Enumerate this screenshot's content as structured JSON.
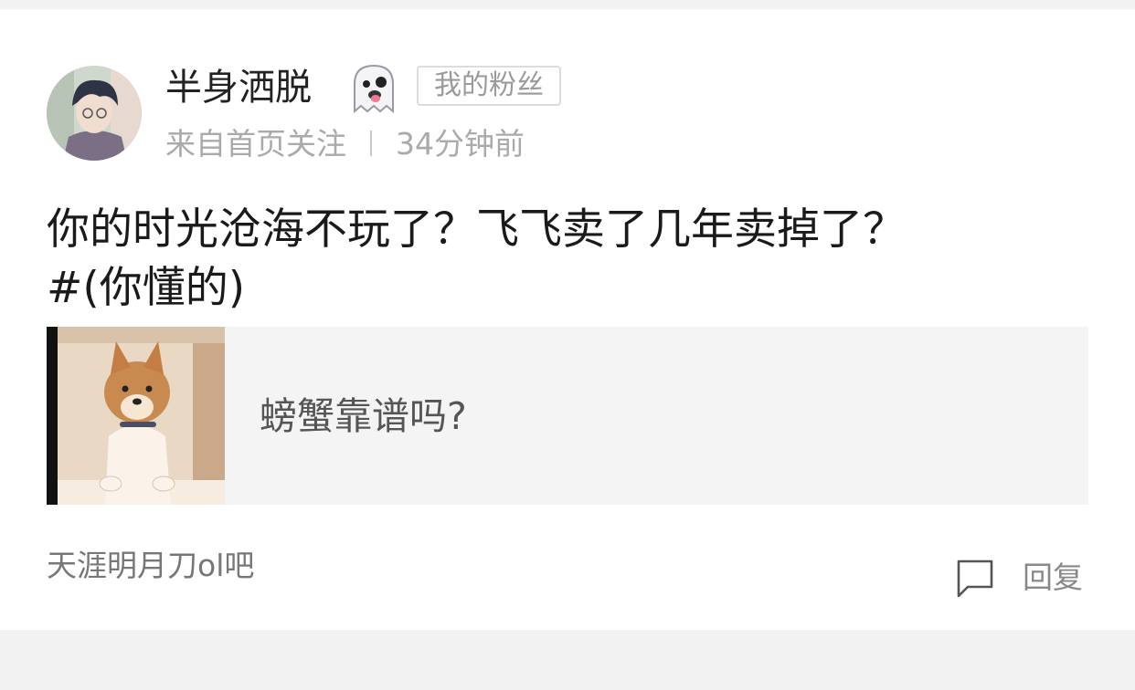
{
  "post": {
    "author": {
      "name": "半身洒脱",
      "emoji_icon": "ghost-tongue-icon",
      "badge": "我的粉丝"
    },
    "meta": {
      "source": "来自首页关注",
      "time": "34分钟前"
    },
    "content": {
      "line1": "你的时光沧海不玩了？飞飞卖了几年卖掉了？",
      "line2": "#(你懂的)"
    },
    "share": {
      "title": "螃蟹靠谱吗?"
    },
    "forum": "天涯明月刀ol吧",
    "actions": {
      "reply_label": "回复",
      "reply_icon": "comment-icon"
    }
  },
  "colors": {
    "page_bg": "#f2f2f2",
    "card_bg": "#ffffff",
    "share_bg": "#f4f4f4",
    "muted_text": "#aaaaaa"
  }
}
